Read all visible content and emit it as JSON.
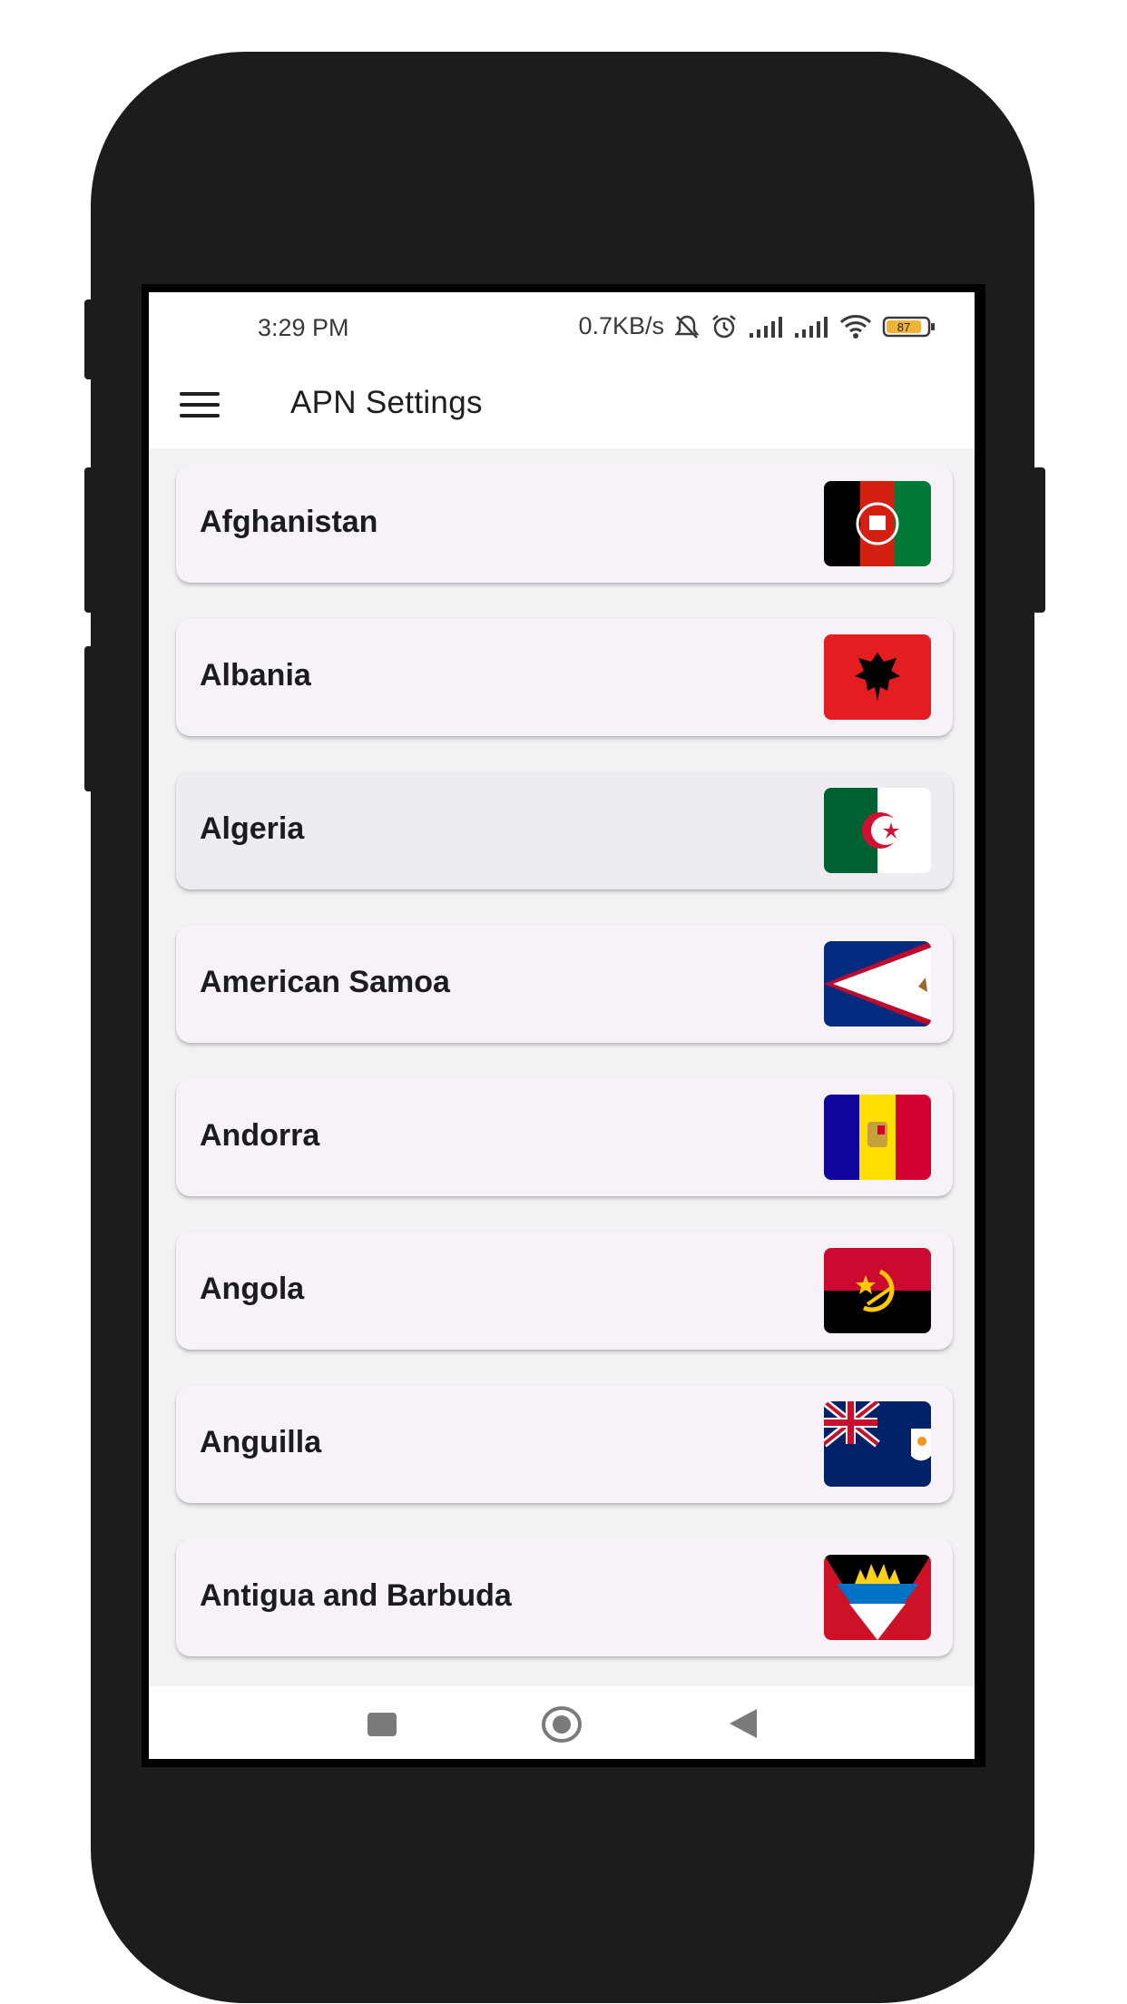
{
  "status_bar": {
    "time": "3:29 PM",
    "network_speed": "0.7KB/s",
    "battery_level": "87",
    "icons": [
      "mute-icon",
      "alarm-icon",
      "signal-icon",
      "signal-icon",
      "wifi-icon",
      "battery-icon"
    ]
  },
  "app_bar": {
    "title": "APN Settings",
    "menu_icon": "hamburger-menu-icon"
  },
  "countries": [
    {
      "name": "Afghanistan",
      "flag": "afghanistan-flag-icon"
    },
    {
      "name": "Albania",
      "flag": "albania-flag-icon"
    },
    {
      "name": "Algeria",
      "flag": "algeria-flag-icon"
    },
    {
      "name": "American Samoa",
      "flag": "american-samoa-flag-icon"
    },
    {
      "name": "Andorra",
      "flag": "andorra-flag-icon"
    },
    {
      "name": "Angola",
      "flag": "angola-flag-icon"
    },
    {
      "name": "Anguilla",
      "flag": "anguilla-flag-icon"
    },
    {
      "name": "Antigua and Barbuda",
      "flag": "antigua-and-barbuda-flag-icon"
    }
  ],
  "nav_bar": {
    "icons": [
      "recents-square-icon",
      "home-circle-icon",
      "back-triangle-icon"
    ]
  },
  "colors": {
    "device_frame": "#1c1c1c",
    "list_background": "#f2f1f4",
    "card_background": "#f6f2f8",
    "text": "#1d1b20"
  }
}
